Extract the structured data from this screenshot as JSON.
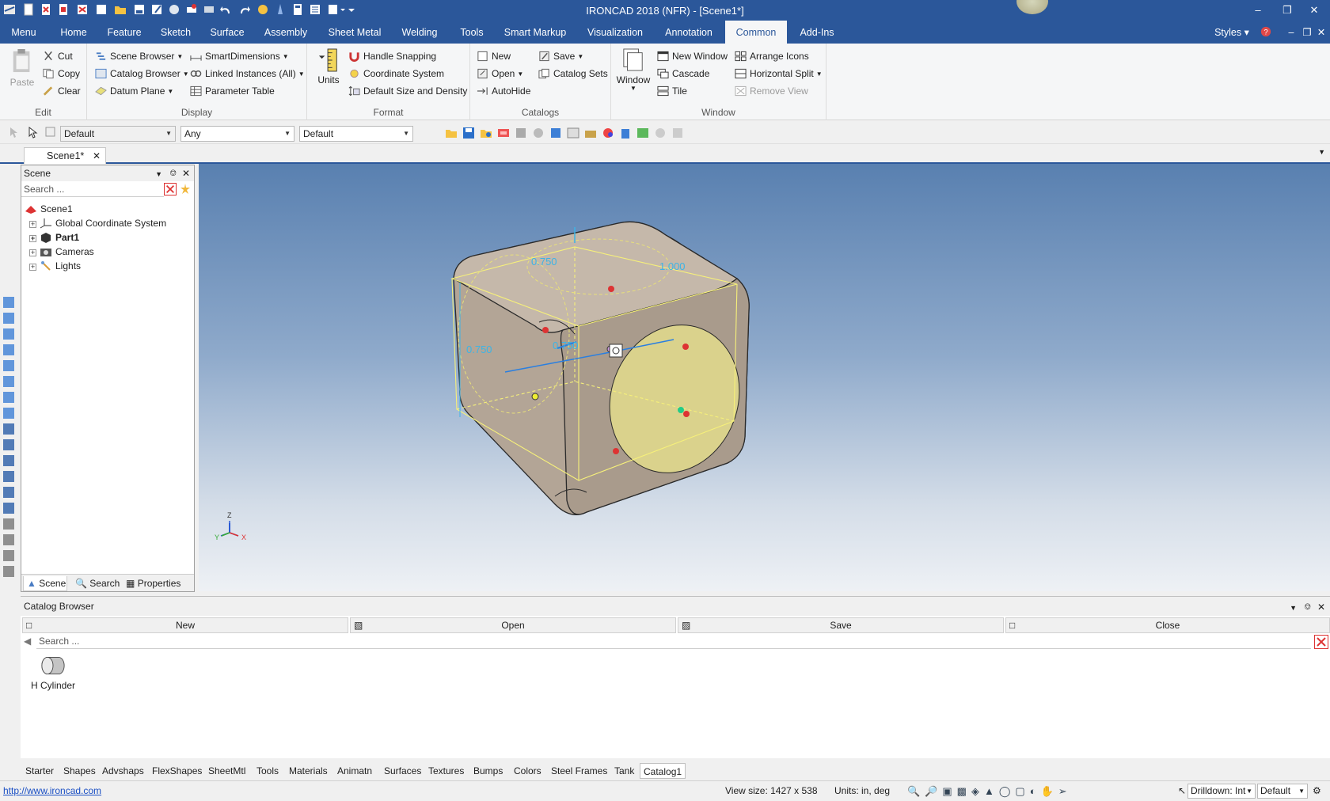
{
  "app": {
    "title": "IRONCAD 2018 (NFR) - [Scene1*]"
  },
  "menu": {
    "tabs": [
      "Menu",
      "Home",
      "Feature",
      "Sketch",
      "Surface",
      "Assembly",
      "Sheet Metal",
      "Welding",
      "Tools",
      "Smart Markup",
      "Visualization",
      "Annotation",
      "Common",
      "Add-Ins"
    ],
    "active": "Common",
    "styles_label": "Styles"
  },
  "ribbon": {
    "edit": {
      "paste": "Paste",
      "cut": "Cut",
      "copy": "Copy",
      "clear": "Clear",
      "label": "Edit"
    },
    "display": {
      "scene_browser": "Scene Browser",
      "catalog_browser": "Catalog Browser",
      "datum_plane": "Datum Plane",
      "smart_dimensions": "SmartDimensions",
      "linked_instances": "Linked Instances (All)",
      "parameter_table": "Parameter Table",
      "label": "Display"
    },
    "format": {
      "units": "Units",
      "handle_snapping": "Handle Snapping",
      "coordinate_system": "Coordinate System",
      "default_size": "Default Size and Density",
      "label": "Format"
    },
    "catalogs": {
      "new": "New",
      "open": "Open",
      "autohide": "AutoHide",
      "save": "Save",
      "catalog_sets": "Catalog Sets",
      "label": "Catalogs"
    },
    "window": {
      "window": "Window",
      "new_window": "New Window",
      "cascade": "Cascade",
      "tile": "Tile",
      "arrange_icons": "Arrange Icons",
      "horizontal_split": "Horizontal Split",
      "remove_view": "Remove View",
      "label": "Window"
    }
  },
  "toolbar": {
    "combo1": "Default",
    "combo2": "Any",
    "combo3": "Default"
  },
  "doc_tab": {
    "label": "Scene1*"
  },
  "scene_panel": {
    "title": "Scene",
    "search_placeholder": "Search ...",
    "tree": [
      {
        "label": "Scene1",
        "bold": false
      },
      {
        "label": "Global Coordinate System",
        "bold": false
      },
      {
        "label": "Part1",
        "bold": true
      },
      {
        "label": "Cameras",
        "bold": false
      },
      {
        "label": "Lights",
        "bold": false
      }
    ],
    "tabs": [
      "Scene",
      "Search",
      "Properties"
    ]
  },
  "viewport": {
    "dim_top_left": "0.750",
    "dim_top_right": "1.000",
    "dim_left": "0.750",
    "dim_center": "0.750",
    "axis_z": "Z",
    "axis_y": "Y",
    "axis_x": "X"
  },
  "catalog": {
    "title": "Catalog Browser",
    "buttons": [
      "New",
      "Open",
      "Save",
      "Close"
    ],
    "search_placeholder": "Search ...",
    "item_label": "H Cylinder"
  },
  "bottom_tabs": [
    "Starter",
    "Shapes",
    "Advshaps",
    "FlexShapes",
    "SheetMtl",
    "Tools",
    "Materials",
    "Animatn",
    "Surfaces",
    "Textures",
    "Bumps",
    "Colors",
    "Steel Frames",
    "Tank",
    "Catalog1"
  ],
  "bottom_tabs_active": "Catalog1",
  "status": {
    "link": "http://www.ironcad.com",
    "view_size": "View size: 1427 x  538",
    "units": "Units: in, deg",
    "drilldown": "Drilldown: Int",
    "default": "Default"
  },
  "colors": {
    "accent": "#2b579a",
    "part": "#b3a596",
    "highlight": "#e6e08c"
  }
}
